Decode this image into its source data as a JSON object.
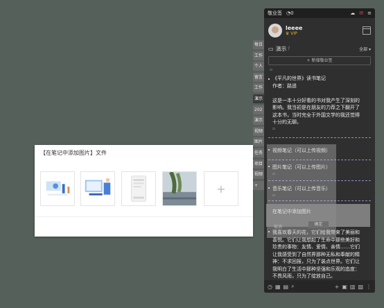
{
  "dialog": {
    "title": "【在笔记中添加图片】文件",
    "add_symbol": "+"
  },
  "tabs": [
    "每日",
    "工作",
    "个人",
    "留言",
    "工作",
    "演示",
    "202",
    "演示",
    "视频",
    "图片",
    "任务",
    "项目",
    "视频",
    "+"
  ],
  "panel": {
    "topbar": {
      "title": "敬业签",
      "count_symbol": "0"
    },
    "user": {
      "name": "leeee",
      "badge": "VIP"
    },
    "section": {
      "name": "演示",
      "count": "7",
      "filter": "全部"
    },
    "new_button": "+ 新增敬业签",
    "notes": [
      {
        "lines": [
          "《平凡的世界》读书笔记",
          "作者：路遥",
          "",
          "这是一本十分好看的书对我产生了深刻的",
          "影响。我当初是在朋友的力荐之下翻开了",
          "这本书，当时完全于外国文学的我还觉得",
          "十分的无聊。"
        ]
      },
      {
        "lines": [
          "视频笔记（可以上传视频）"
        ]
      },
      {
        "lines": [
          "图片笔记（可以上传图片）"
        ]
      },
      {
        "lines": [
          "音乐笔记（可以上传音乐）"
        ]
      },
      {
        "lines": [
          "我喜欢春天的花，它们给我带来了美丽和",
          "喜悦。它们让我想起了生命中那些美好和",
          "珍贵的事物：友情、爱情、亲情……它们",
          "让我感受到了自然界那种无私和奉献的精",
          "神：不求回报，只为了装点世界。它们让",
          "我明白了生活中那种坚强和乐观的态度：",
          "不畏风雨，只为了绽放自己。"
        ]
      }
    ]
  },
  "ghost": {
    "title": "在笔记中添加图片",
    "cancel": "取消",
    "ok": "确定"
  }
}
